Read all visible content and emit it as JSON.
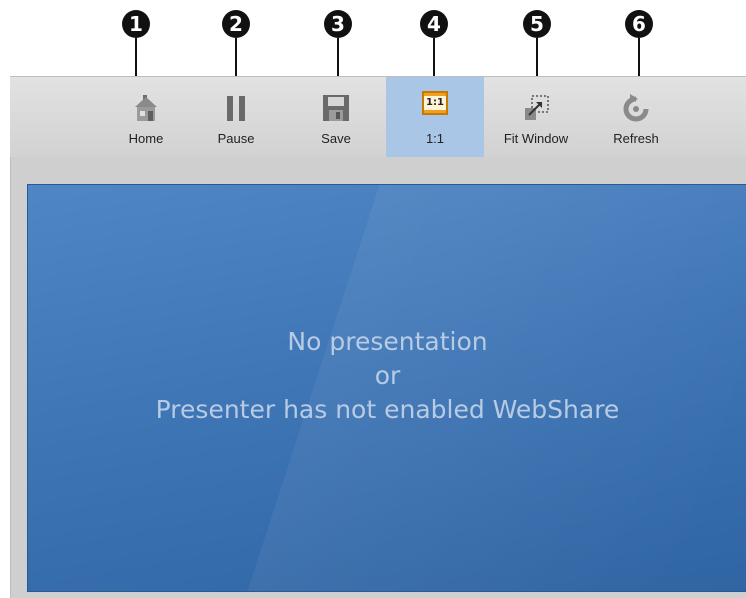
{
  "callouts": [
    "1",
    "2",
    "3",
    "4",
    "5",
    "6"
  ],
  "toolbar": {
    "items": [
      {
        "label": "Home",
        "icon": "home-icon"
      },
      {
        "label": "Pause",
        "icon": "pause-icon"
      },
      {
        "label": "Save",
        "icon": "save-icon"
      },
      {
        "label": "1:1",
        "icon": "actual-size-icon",
        "icon_text": "1:1",
        "active": true
      },
      {
        "label": "Fit Window",
        "icon": "fit-window-icon"
      },
      {
        "label": "Refresh",
        "icon": "refresh-icon"
      }
    ]
  },
  "stage": {
    "line1": "No presentation",
    "line2": "or",
    "line3": "Presenter has not enabled WebShare"
  },
  "colors": {
    "toolbar_bg": "#d8d8d8",
    "active_bg": "#a9c6e6",
    "stage_bg": "#3f76b6",
    "message": "#b7cbe4"
  }
}
